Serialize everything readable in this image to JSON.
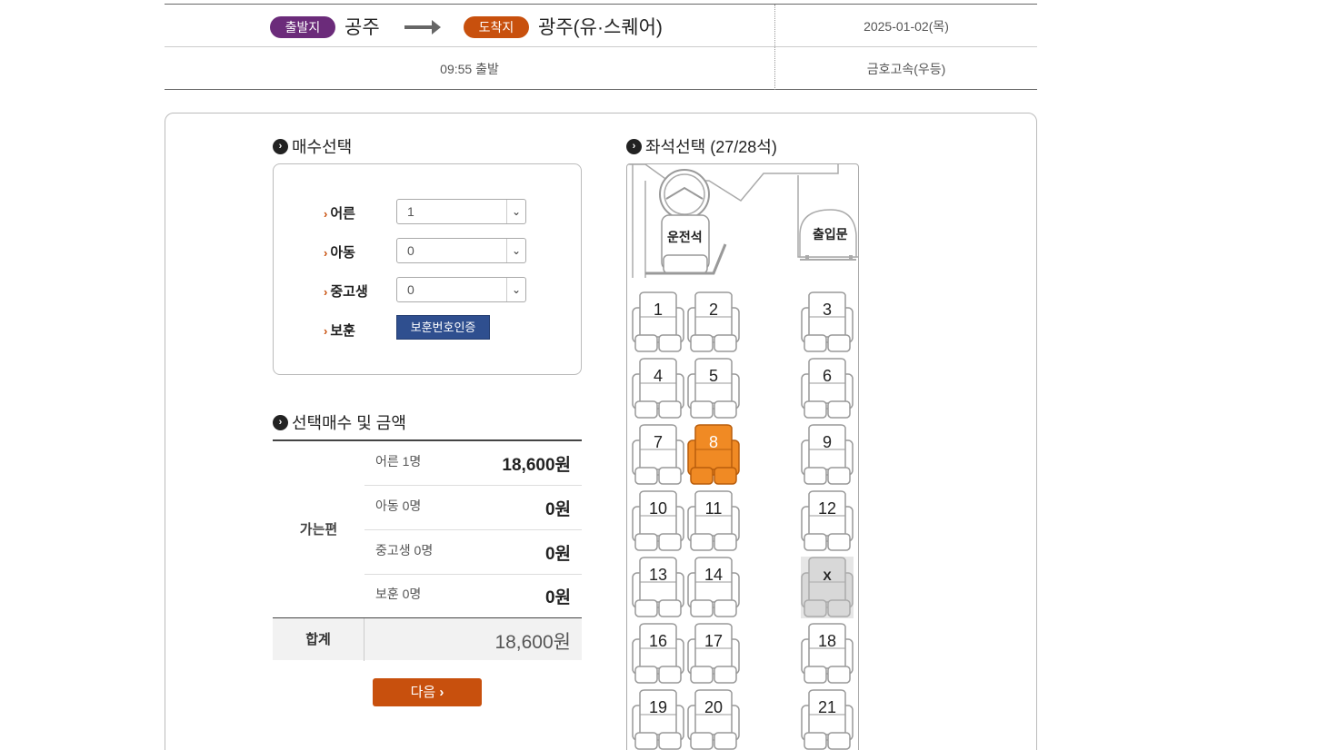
{
  "route": {
    "departure_badge": "출발지",
    "departure_city": "공주",
    "arrival_badge": "도착지",
    "arrival_city": "광주(유·스퀘어)",
    "date": "2025-01-02(목)",
    "time": "09:55 출발",
    "company": "금호고속(우등)"
  },
  "count_select": {
    "title": "매수선택",
    "rows": [
      {
        "label": "어른",
        "value": "1"
      },
      {
        "label": "아동",
        "value": "0"
      },
      {
        "label": "중고생",
        "value": "0"
      }
    ],
    "veteran_label": "보훈",
    "veteran_button": "보훈번호인증"
  },
  "price_summary": {
    "title": "선택매수 및 금액",
    "direction": "가는편",
    "rows": [
      {
        "label": "어른 1명",
        "value": "18,600원"
      },
      {
        "label": "아동 0명",
        "value": "0원"
      },
      {
        "label": "중고생 0명",
        "value": "0원"
      },
      {
        "label": "보훈 0명",
        "value": "0원"
      }
    ],
    "total_label": "합계",
    "total_value": "18,600원",
    "next_button": "다음"
  },
  "seat_map": {
    "title": "좌석선택 (27/28석)",
    "driver_label": "운전석",
    "door_label": "출입문",
    "seats": [
      {
        "label": "1",
        "state": "available"
      },
      {
        "label": "2",
        "state": "available"
      },
      {
        "label": "3",
        "state": "available"
      },
      {
        "label": "4",
        "state": "available"
      },
      {
        "label": "5",
        "state": "available"
      },
      {
        "label": "6",
        "state": "available"
      },
      {
        "label": "7",
        "state": "available"
      },
      {
        "label": "8",
        "state": "selected"
      },
      {
        "label": "9",
        "state": "available"
      },
      {
        "label": "10",
        "state": "available"
      },
      {
        "label": "11",
        "state": "available"
      },
      {
        "label": "12",
        "state": "available"
      },
      {
        "label": "13",
        "state": "available"
      },
      {
        "label": "14",
        "state": "available"
      },
      {
        "label": "X",
        "state": "taken"
      },
      {
        "label": "16",
        "state": "available"
      },
      {
        "label": "17",
        "state": "available"
      },
      {
        "label": "18",
        "state": "available"
      },
      {
        "label": "19",
        "state": "available"
      },
      {
        "label": "20",
        "state": "available"
      },
      {
        "label": "21",
        "state": "available"
      }
    ]
  },
  "colors": {
    "departure": "#6b2b7a",
    "arrival": "#c8500d",
    "selected_seat": "#f08a24",
    "taken_seat": "#d8d8d8",
    "button_blue": "#2f4f8f",
    "button_next": "#c8500d"
  }
}
